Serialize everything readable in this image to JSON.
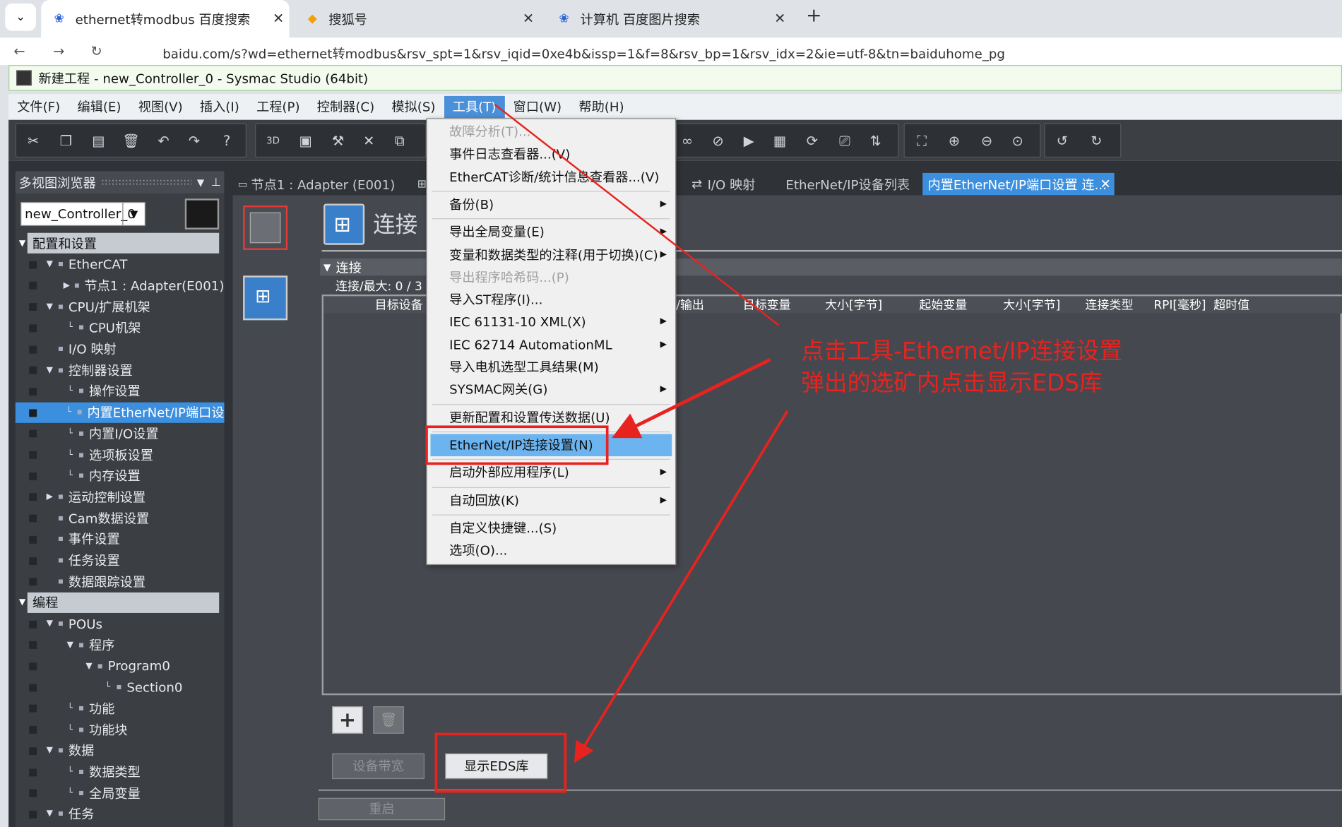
{
  "browser": {
    "tabs": [
      {
        "title": "ethernet转modbus 百度搜索",
        "icon": "baidu-paw-icon",
        "active": true
      },
      {
        "title": "搜狐号",
        "icon": "sohu-icon",
        "active": false
      },
      {
        "title": "计算机 百度图片搜索",
        "icon": "baidu-paw-icon",
        "active": false
      }
    ],
    "url": "baidu.com/s?wd=ethernet转modbus&rsv_spt=1&rsv_iqid=0xe4b&issp=1&f=8&rsv_bp=1&rsv_idx=2&ie=utf-8&tn=baiduhome_pg"
  },
  "app": {
    "title": "新建工程 - new_Controller_0 - Sysmac Studio (64bit)",
    "menu": [
      "文件(F)",
      "编辑(E)",
      "视图(V)",
      "插入(I)",
      "工程(P)",
      "控制器(C)",
      "模拟(S)",
      "工具(T)",
      "窗口(W)",
      "帮助(H)"
    ],
    "active_menu": "工具(T)"
  },
  "left_panel": {
    "header": "多视图浏览器",
    "controller": "new_Controller_0",
    "tree": [
      {
        "label": "配置和设置",
        "type": "section"
      },
      {
        "label": "EtherCAT",
        "level": 1
      },
      {
        "label": "节点1 : Adapter(E001)",
        "level": 2
      },
      {
        "label": "CPU/扩展机架",
        "level": 1
      },
      {
        "label": "CPU机架",
        "level": 2
      },
      {
        "label": "I/O 映射",
        "level": 1
      },
      {
        "label": "控制器设置",
        "level": 1
      },
      {
        "label": "操作设置",
        "level": 2
      },
      {
        "label": "内置EtherNet/IP端口设",
        "level": 2,
        "selected": true
      },
      {
        "label": "内置I/O设置",
        "level": 2
      },
      {
        "label": "选项板设置",
        "level": 2
      },
      {
        "label": "内存设置",
        "level": 2
      },
      {
        "label": "运动控制设置",
        "level": 1
      },
      {
        "label": "Cam数据设置",
        "level": 1
      },
      {
        "label": "事件设置",
        "level": 1
      },
      {
        "label": "任务设置",
        "level": 1
      },
      {
        "label": "数据跟踪设置",
        "level": 1
      },
      {
        "label": "编程",
        "type": "section"
      },
      {
        "label": "POUs",
        "level": 1
      },
      {
        "label": "程序",
        "level": 2
      },
      {
        "label": "Program0",
        "level": 3
      },
      {
        "label": "Section0",
        "level": 4
      },
      {
        "label": "功能",
        "level": 2
      },
      {
        "label": "功能块",
        "level": 2
      },
      {
        "label": "数据",
        "level": 1
      },
      {
        "label": "数据类型",
        "level": 2
      },
      {
        "label": "全局变量",
        "level": 2
      },
      {
        "label": "任务",
        "level": 1
      }
    ]
  },
  "editor_tabs": [
    {
      "label": "节点1 : Adapter (E001)"
    },
    {
      "label": "I/O 映射"
    },
    {
      "label": "EtherNet/IP设备列表"
    },
    {
      "label": "内置EtherNet/IP端口设置 连...",
      "active": true
    }
  ],
  "editor": {
    "title": "连接",
    "section": "连接",
    "count": "连接/最大: 0 / 3",
    "columns": [
      "目标设备",
      "/输出",
      "目标变量",
      "大小[字节]",
      "起始变量",
      "大小[字节]",
      "连接类型",
      "RPI[毫秒]",
      "超时值"
    ],
    "buttons": {
      "bandwidth": "设备带宽",
      "show_eds": "显示EDS库",
      "restart": "重启"
    }
  },
  "tools_menu": [
    {
      "label": "故障分析(T)...",
      "disabled": true
    },
    {
      "label": "事件日志查看器...(V)"
    },
    {
      "label": "EtherCAT诊断/统计信息查看器...(V)"
    },
    {
      "sep": true
    },
    {
      "label": "备份(B)",
      "submenu": true
    },
    {
      "sep": true
    },
    {
      "label": "导出全局变量(E)",
      "submenu": true
    },
    {
      "label": "变量和数据类型的注释(用于切换)(C)",
      "submenu": true
    },
    {
      "label": "导出程序哈希码...(P)",
      "disabled": true
    },
    {
      "label": "导入ST程序(I)..."
    },
    {
      "label": "IEC 61131-10 XML(X)",
      "submenu": true
    },
    {
      "label": "IEC 62714 AutomationML",
      "submenu": true
    },
    {
      "label": "导入电机选型工具结果(M)"
    },
    {
      "label": "SYSMAC网关(G)",
      "submenu": true
    },
    {
      "sep": true
    },
    {
      "label": "更新配置和设置传送数据(U)"
    },
    {
      "sep": true
    },
    {
      "label": "EtherNet/IP连接设置(N)",
      "highlighted": true
    },
    {
      "sep": true
    },
    {
      "label": "启动外部应用程序(L)",
      "submenu": true
    },
    {
      "sep": true
    },
    {
      "label": "自动回放(K)",
      "submenu": true
    },
    {
      "sep": true
    },
    {
      "label": "自定义快捷键...(S)"
    },
    {
      "label": "选项(O)..."
    }
  ],
  "annotation": {
    "line1": "点击工具-Ethernet/IP连接设置",
    "line2": "弹出的选矿内点击显示EDS库",
    "color": "#e8231f"
  }
}
